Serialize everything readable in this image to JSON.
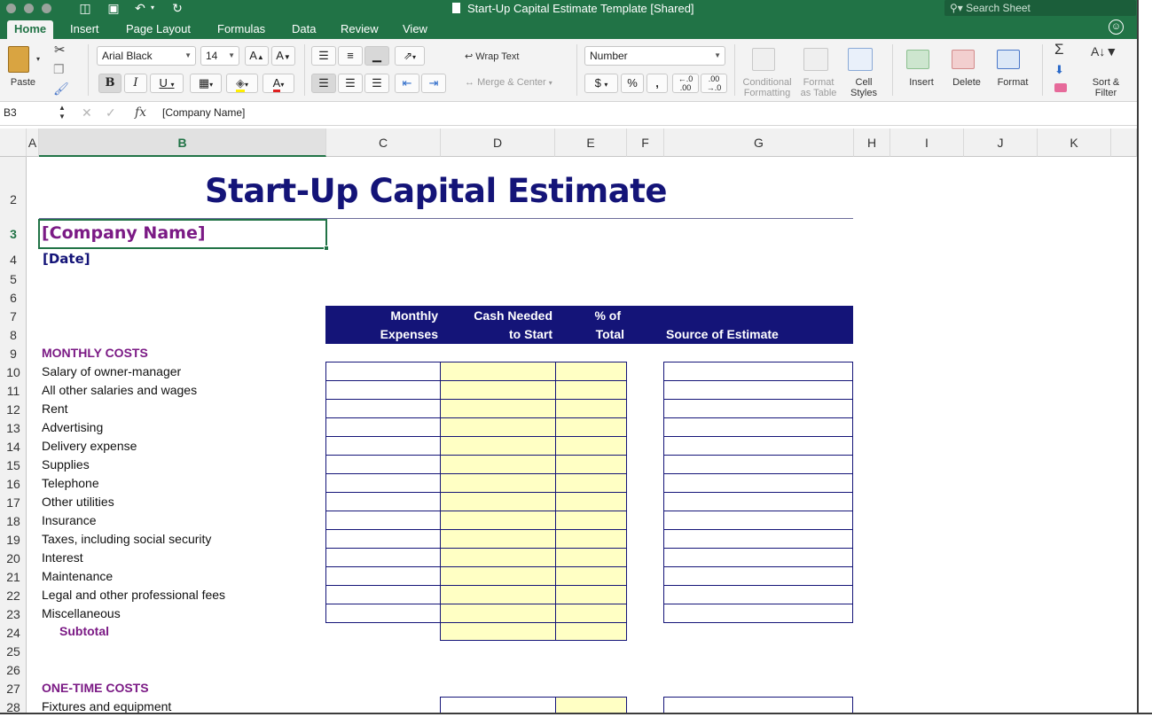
{
  "window": {
    "title": "Start-Up Capital Estimate Template  [Shared]",
    "search_placeholder": "Search Sheet"
  },
  "tabs": [
    "Home",
    "Insert",
    "Page Layout",
    "Formulas",
    "Data",
    "Review",
    "View"
  ],
  "ribbon": {
    "paste": "Paste",
    "font_name": "Arial Black",
    "font_size": "14",
    "bold": "B",
    "italic": "I",
    "underline": "U",
    "wrap_text": "Wrap Text",
    "merge_center": "Merge & Center",
    "number_format": "Number",
    "currency": "$",
    "percent": "%",
    "comma": ",",
    "conditional_formatting": [
      "Conditional",
      "Formatting"
    ],
    "format_as_table": [
      "Format",
      "as Table"
    ],
    "cell_styles": [
      "Cell",
      "Styles"
    ],
    "insert": "Insert",
    "delete": "Delete",
    "format": "Format",
    "sort_filter": [
      "Sort &",
      "Filter"
    ]
  },
  "formula_bar": {
    "name_box": "B3",
    "fx": "fx",
    "content": "[Company Name]"
  },
  "columns": [
    "A",
    "B",
    "C",
    "D",
    "E",
    "F",
    "G",
    "H",
    "I",
    "J",
    "K"
  ],
  "rows": [
    "2",
    "3",
    "4",
    "5",
    "6",
    "7",
    "8",
    "9",
    "10",
    "11",
    "12",
    "13",
    "14",
    "15",
    "16",
    "17",
    "18",
    "19",
    "20",
    "21",
    "22",
    "23",
    "24",
    "25",
    "26",
    "27",
    "28"
  ],
  "sheet": {
    "title": "Start-Up Capital Estimate",
    "company": "[Company Name]",
    "date": "[Date]",
    "headers": {
      "monthly_1": "Monthly",
      "monthly_2": "Expenses",
      "cash_1": "Cash Needed",
      "cash_2": "to Start",
      "pct_1": "% of",
      "pct_2": "Total",
      "source": "Source of Estimate"
    },
    "monthly_costs_label": "MONTHLY COSTS",
    "monthly_items": [
      "Salary of owner-manager",
      "All other salaries and wages",
      "Rent",
      "Advertising",
      "Delivery expense",
      "Supplies",
      "Telephone",
      "Other utilities",
      "Insurance",
      "Taxes, including social security",
      "Interest",
      "Maintenance",
      "Legal and other professional fees",
      "Miscellaneous"
    ],
    "subtotal_label": "Subtotal",
    "one_time_label": "ONE-TIME COSTS",
    "one_time_items": [
      "Fixtures and equipment"
    ]
  },
  "colors": {
    "excel_green": "#217346",
    "header_navy": "#141478",
    "section_purple": "#7b1a85",
    "input_yellow": "#ffffc4"
  }
}
